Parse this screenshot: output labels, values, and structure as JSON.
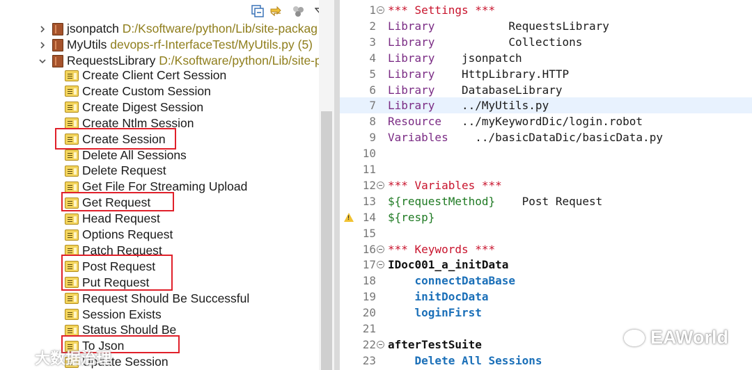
{
  "left_pane": {
    "libraries": [
      {
        "name": "jsonpatch",
        "path": "D:/Ksoftware/python/Lib/site-packag",
        "expanded": false
      },
      {
        "name": "MyUtils",
        "path": "devops-rf-InterfaceTest/MyUtils.py (5)",
        "expanded": false
      },
      {
        "name": "RequestsLibrary",
        "path": "D:/Ksoftware/python/Lib/site-p",
        "expanded": true
      }
    ],
    "keywords": [
      "Create Client Cert Session",
      "Create Custom Session",
      "Create Digest Session",
      "Create Ntlm Session",
      "Create Session",
      "Delete All Sessions",
      "Delete Request",
      "Get File For Streaming Upload",
      "Get Request",
      "Head Request",
      "Options Request",
      "Patch Request",
      "Post Request",
      "Put Request",
      "Request Should Be Successful",
      "Session Exists",
      "Status Should Be",
      "To Json",
      "Update Session"
    ],
    "toolbar": [
      "collapse-all-icon",
      "link-with-editor-icon",
      "filter-icon",
      "view-menu-icon"
    ],
    "highlight_color": "#e0202a"
  },
  "editor": {
    "current_line": 7,
    "lines": [
      {
        "n": "1",
        "fold": true,
        "parts": [
          {
            "t": "*** Settings ***",
            "c": "section"
          }
        ]
      },
      {
        "n": "2",
        "parts": [
          {
            "t": "Library",
            "c": "setting"
          },
          {
            "t": "           RequestsLibrary",
            "c": "plain"
          }
        ]
      },
      {
        "n": "3",
        "parts": [
          {
            "t": "Library",
            "c": "setting"
          },
          {
            "t": "           Collections",
            "c": "plain"
          }
        ]
      },
      {
        "n": "4",
        "parts": [
          {
            "t": "Library",
            "c": "setting"
          },
          {
            "t": "    jsonpatch",
            "c": "plain"
          }
        ]
      },
      {
        "n": "5",
        "parts": [
          {
            "t": "Library",
            "c": "setting"
          },
          {
            "t": "    HttpLibrary.HTTP",
            "c": "plain"
          }
        ]
      },
      {
        "n": "6",
        "parts": [
          {
            "t": "Library",
            "c": "setting"
          },
          {
            "t": "    DatabaseLibrary",
            "c": "plain"
          }
        ]
      },
      {
        "n": "7",
        "parts": [
          {
            "t": "Library",
            "c": "setting"
          },
          {
            "t": "    ../MyUtils.py",
            "c": "plain"
          }
        ]
      },
      {
        "n": "8",
        "parts": [
          {
            "t": "Resource",
            "c": "setting"
          },
          {
            "t": "   ../myKeywordDic/login.robot",
            "c": "plain"
          }
        ]
      },
      {
        "n": "9",
        "parts": [
          {
            "t": "Variables",
            "c": "setting"
          },
          {
            "t": "    ../basicDataDic/basicData.py",
            "c": "plain"
          }
        ]
      },
      {
        "n": "10",
        "parts": []
      },
      {
        "n": "11",
        "parts": []
      },
      {
        "n": "12",
        "fold": true,
        "parts": [
          {
            "t": "*** Variables ***",
            "c": "section"
          }
        ]
      },
      {
        "n": "13",
        "parts": [
          {
            "t": "${requestMethod}",
            "c": "var"
          },
          {
            "t": "    Post Request",
            "c": "plain"
          }
        ]
      },
      {
        "n": "14",
        "warn": true,
        "parts": [
          {
            "t": "${resp}",
            "c": "var"
          }
        ]
      },
      {
        "n": "15",
        "parts": []
      },
      {
        "n": "16",
        "fold": true,
        "parts": [
          {
            "t": "*** Keywords ***",
            "c": "section"
          }
        ]
      },
      {
        "n": "17",
        "fold": true,
        "parts": [
          {
            "t": "IDoc001_a_initData",
            "c": "bold"
          }
        ]
      },
      {
        "n": "18",
        "parts": [
          {
            "t": "    ",
            "c": "plain"
          },
          {
            "t": "connectDataBase",
            "c": "kwcall"
          }
        ]
      },
      {
        "n": "19",
        "parts": [
          {
            "t": "    ",
            "c": "plain"
          },
          {
            "t": "initDocData",
            "c": "kwcall"
          }
        ]
      },
      {
        "n": "20",
        "parts": [
          {
            "t": "    ",
            "c": "plain"
          },
          {
            "t": "loginFirst",
            "c": "kwcall"
          }
        ]
      },
      {
        "n": "21",
        "parts": []
      },
      {
        "n": "22",
        "fold": true,
        "parts": [
          {
            "t": "afterTestSuite",
            "c": "bold"
          }
        ]
      },
      {
        "n": "23",
        "parts": [
          {
            "t": "    ",
            "c": "plain"
          },
          {
            "t": "Delete All Sessions",
            "c": "kwcall"
          }
        ]
      }
    ]
  },
  "watermarks": {
    "left": "大数据治理",
    "right": "EAWorld"
  }
}
